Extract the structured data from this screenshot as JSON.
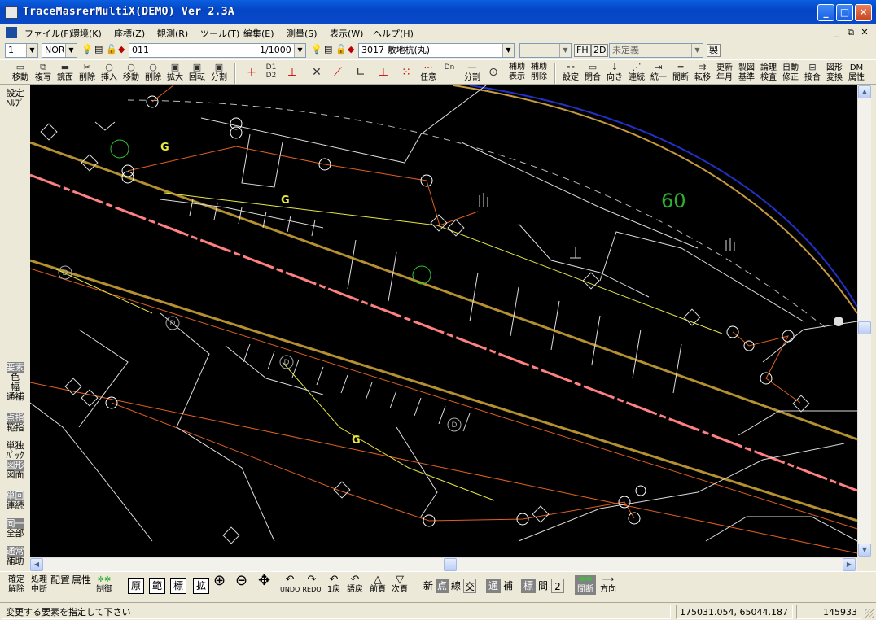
{
  "window": {
    "title": "TraceMasrerMultiX(DEMO) Ver 2.3A",
    "min": "_",
    "max": "□",
    "close": "✕"
  },
  "menu": {
    "items": [
      "ファイル(F)",
      "環境(K)",
      "座標(Z)",
      "観測(R)",
      "ツール(T)",
      "編集(E)",
      "測量(S)",
      "表示(W)",
      "ヘルプ(H)"
    ],
    "mdi": [
      "_",
      "⧉",
      "✕"
    ]
  },
  "toolbar1": {
    "layer": "1",
    "mode": "NOR",
    "code_left": "011",
    "scale": "1/1000",
    "code_right": "3017 敷地杭(丸)",
    "empty_combo": "",
    "fh": "FH",
    "twod": "2D",
    "undefined_combo": "未定義",
    "make": "製"
  },
  "toolbar2": {
    "edit_buttons": [
      "移動",
      "複写",
      "鏡面",
      "削除",
      "挿入",
      "移動",
      "削除",
      "拡大",
      "回転",
      "分割"
    ],
    "mid_buttons": [
      "任意",
      "分割",
      "補助表示",
      "補助削除"
    ],
    "right_buttons": [
      "設定",
      "閉合",
      "向き",
      "連続",
      "統一",
      "間断",
      "転移",
      "更新年月",
      "製図基準",
      "論理検査",
      "自動修正",
      "接合",
      "図形変換",
      "DM属性"
    ]
  },
  "leftpanel": {
    "top": [
      "設定",
      "ﾍﾙﾌﾟ"
    ],
    "groups": [
      {
        "lines": [
          "要素",
          "色",
          "幅",
          "通補"
        ]
      },
      {
        "lines": [
          "点指",
          "範指"
        ]
      },
      {
        "lines": [
          "単独",
          "ﾊﾟｯｸ",
          "図形",
          "図面"
        ]
      },
      {
        "lines": [
          "単回",
          "連続"
        ]
      },
      {
        "lines": [
          "同一",
          "全部"
        ]
      },
      {
        "lines": [
          "通常",
          "補助"
        ]
      }
    ]
  },
  "map": {
    "labels": [
      "G",
      "G",
      "G",
      "60"
    ],
    "symbol_text": "D"
  },
  "bottombar": {
    "left": [
      "確定解除",
      "処理中断",
      "配置",
      "属性",
      "制御"
    ],
    "boxes": [
      "原",
      "範",
      "標",
      "拡"
    ],
    "nav": [
      "UNDO",
      "REDO",
      "1戻",
      "語戻",
      "前頁",
      "次頁"
    ],
    "seg1": [
      "新",
      "点",
      "線",
      "交"
    ],
    "seg2": [
      "通",
      "補"
    ],
    "seg3": [
      "標",
      "間",
      "2"
    ],
    "right": [
      "間断",
      "方向"
    ]
  },
  "status": {
    "message": "変更する要素を指定して下さい",
    "coords": "175031.054,  65044.187",
    "count": "145933"
  }
}
